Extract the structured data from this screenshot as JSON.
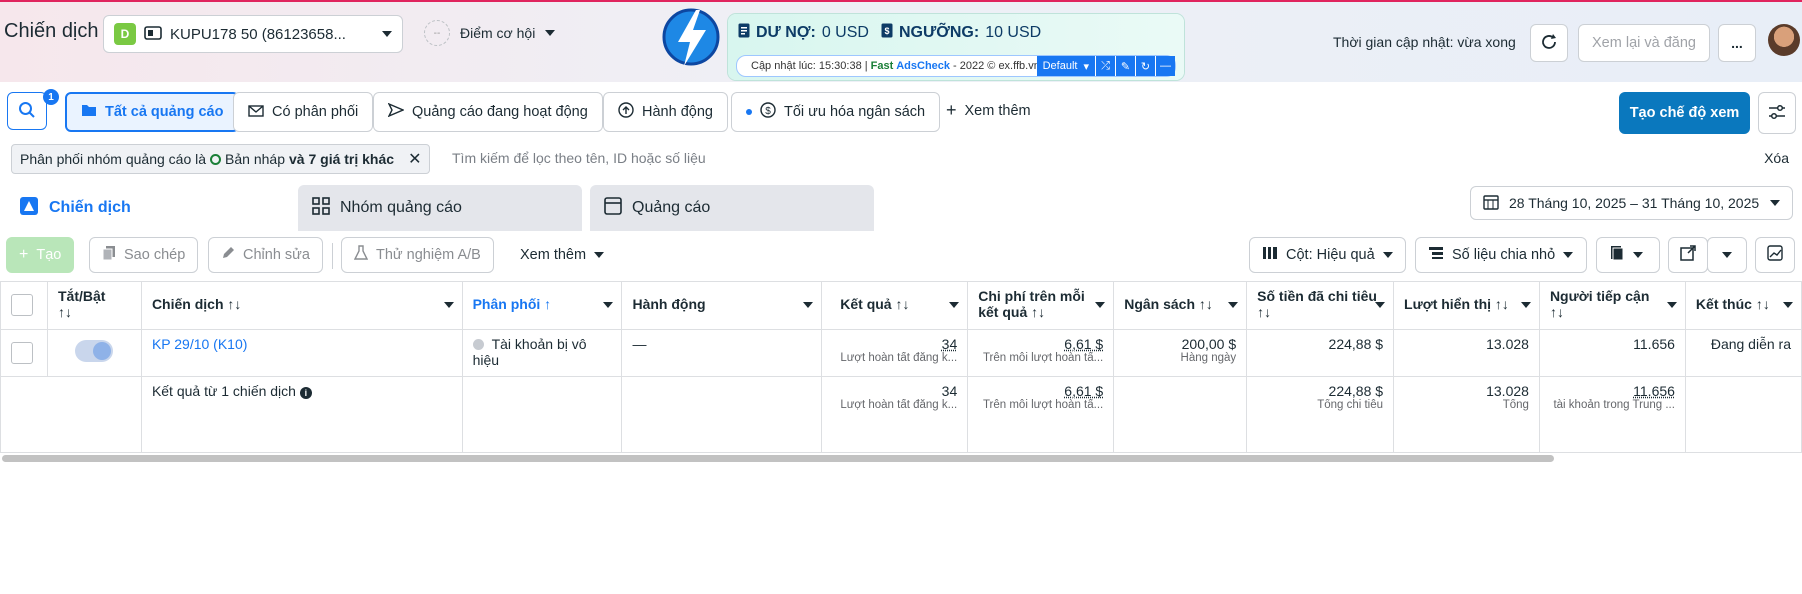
{
  "header": {
    "title": "Chiến dịch",
    "account_badge": "D",
    "account_name": "KUPU178 50 (86123658...",
    "opportunity_score_placeholder": "--",
    "opportunity_label": "Điểm cơ hội",
    "update_status": "Thời gian cập nhật: vừa xong",
    "review_publish": "Xem lại và đăng",
    "more_menu": "..."
  },
  "extension": {
    "debt_label": "DƯ NỢ:",
    "debt_value": "0 USD",
    "threshold_label": "NGƯỠNG:",
    "threshold_value": "10 USD",
    "updated_prefix": "Cập nhật lúc: 15:30:38 |",
    "brand_fast": "Fast",
    "brand_adscheck": "AdsCheck",
    "copyright": "- 2022 © ex.ffb.vn",
    "profile": "Default"
  },
  "filters": {
    "search_badge": "1",
    "chips": [
      "Tất cả quảng cáo",
      "Có phân phối",
      "Quảng cáo đang hoạt động",
      "Hành động",
      "Tối ưu hóa ngân sách"
    ],
    "see_more": "Xem thêm",
    "create_view": "Tạo chế độ xem"
  },
  "filter_bar": {
    "pill_prefix": "Phân phối nhóm quảng cáo là",
    "pill_value": "Bản nháp",
    "pill_more": "và 7 giá trị khác",
    "search_placeholder": "Tìm kiếm để lọc theo tên, ID hoặc số liệu",
    "clear": "Xóa"
  },
  "tabs": [
    "Chiến dịch",
    "Nhóm quảng cáo",
    "Quảng cáo"
  ],
  "date_range": "28 Tháng 10, 2025 – 31 Tháng 10, 2025",
  "toolbar": {
    "create": "Tạo",
    "copy": "Sao chép",
    "edit": "Chỉnh sửa",
    "ab_test": "Thử nghiệm A/B",
    "see_more": "Xem thêm",
    "columns": "Cột: Hiệu quả",
    "breakdown": "Số liệu chia nhỏ"
  },
  "table": {
    "headers": [
      "Tắt/Bật",
      "Chiến dịch",
      "Phân phối",
      "Hành động",
      "Kết quả",
      "Chi phí trên mỗi kết quả",
      "Ngân sách",
      "Số tiền đã chi tiêu",
      "Lượt hiển thị",
      "Người tiếp cận",
      "Kết thúc"
    ],
    "row": {
      "campaign": "KP 29/10 (K10)",
      "delivery": "Tài khoản bị vô hiệu",
      "action": "—",
      "results": "34",
      "results_sub": "Lượt hoàn tất đăng k...",
      "cpr": "6,61 $",
      "cpr_sub": "Trên mỗi lượt hoàn tấ...",
      "budget": "200,00 $",
      "budget_sub": "Hàng ngày",
      "spent": "224,88 $",
      "impressions": "13.028",
      "reach": "11.656",
      "end": "Đang diễn ra"
    },
    "summary": {
      "label": "Kết quả từ 1 chiến dịch",
      "results": "34",
      "results_sub": "Lượt hoàn tất đăng k...",
      "cpr": "6,61 $",
      "cpr_sub": "Trên mỗi lượt hoàn tấ...",
      "spent": "224,88 $",
      "spent_sub": "Tổng chi tiêu",
      "impressions": "13.028",
      "impressions_sub": "Tổng",
      "reach": "11.656",
      "reach_sub": "tài khoản trong Trung ..."
    }
  }
}
